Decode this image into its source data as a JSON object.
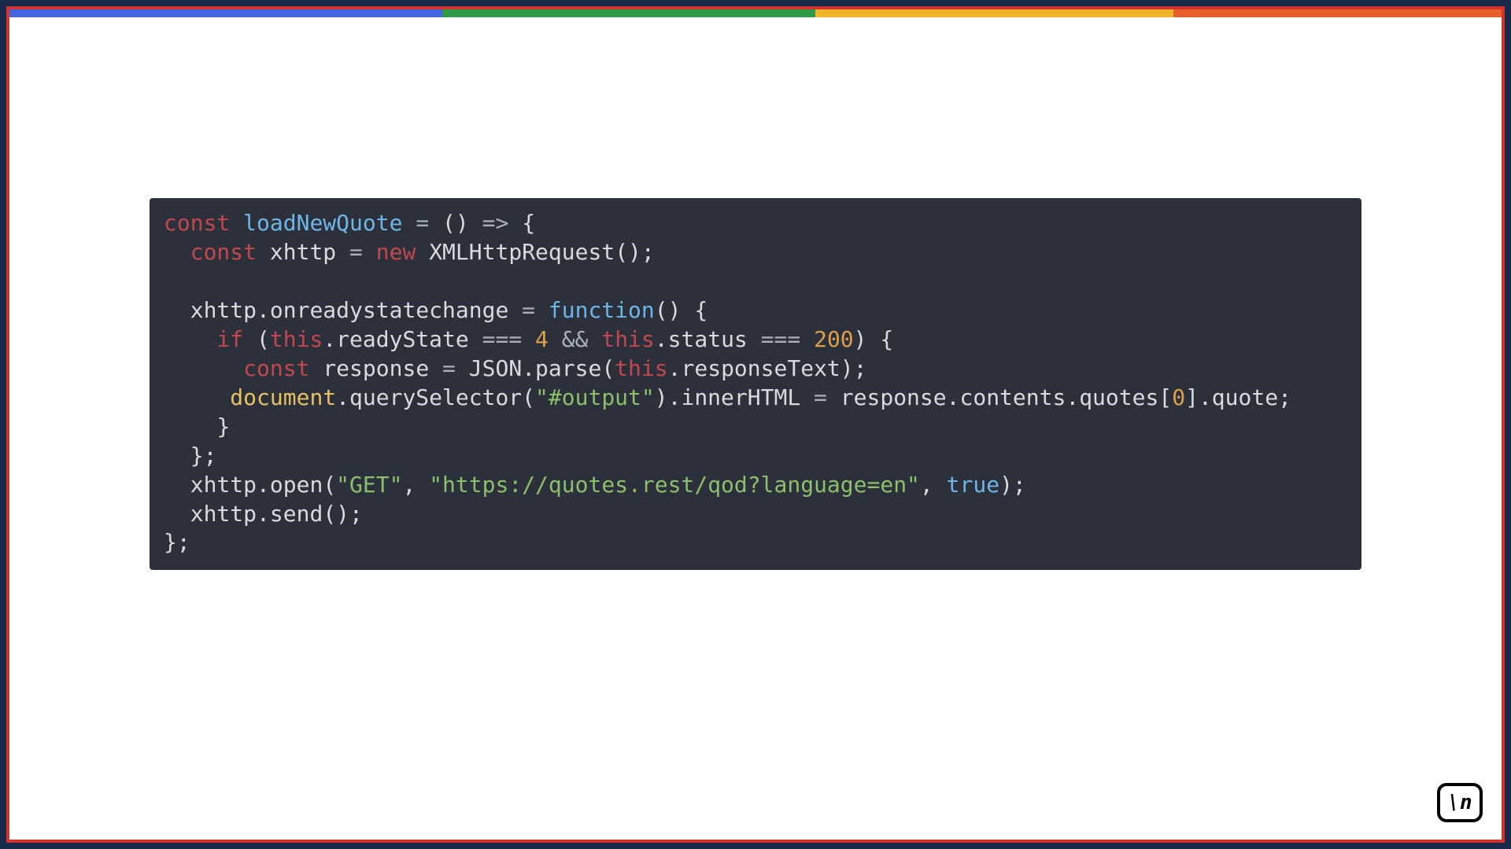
{
  "top_stripe_colors": [
    "#4366e0",
    "#2e9a47",
    "#f0b429",
    "#e95f2b"
  ],
  "frame_border_color": "#d0342c",
  "code_background": "#2b303b",
  "badge_text": "\\n",
  "code": {
    "tokens": [
      [
        {
          "t": "const",
          "c": "kw"
        },
        {
          "t": " "
        },
        {
          "t": "loadNewQuote",
          "c": "fn"
        },
        {
          "t": " "
        },
        {
          "t": "=",
          "c": "op"
        },
        {
          "t": " "
        },
        {
          "t": "(",
          "c": "punc"
        },
        {
          "t": ")",
          "c": "punc"
        },
        {
          "t": " "
        },
        {
          "t": "=>",
          "c": "op"
        },
        {
          "t": " "
        },
        {
          "t": "{",
          "c": "punc"
        }
      ],
      [
        {
          "t": "  "
        },
        {
          "t": "const",
          "c": "kw"
        },
        {
          "t": " "
        },
        {
          "t": "xhttp",
          "c": "def"
        },
        {
          "t": " "
        },
        {
          "t": "=",
          "c": "op"
        },
        {
          "t": " "
        },
        {
          "t": "new",
          "c": "new"
        },
        {
          "t": " "
        },
        {
          "t": "XMLHttpRequest",
          "c": "type"
        },
        {
          "t": "();",
          "c": "punc"
        }
      ],
      [
        {
          "t": " "
        }
      ],
      [
        {
          "t": "  "
        },
        {
          "t": "xhttp",
          "c": "def"
        },
        {
          "t": ".",
          "c": "punc"
        },
        {
          "t": "onreadystatechange",
          "c": "prop"
        },
        {
          "t": " "
        },
        {
          "t": "=",
          "c": "op"
        },
        {
          "t": " "
        },
        {
          "t": "function",
          "c": "funcdef"
        },
        {
          "t": "()",
          "c": "punc"
        },
        {
          "t": " "
        },
        {
          "t": "{",
          "c": "punc"
        }
      ],
      [
        {
          "t": "    "
        },
        {
          "t": "if",
          "c": "kw"
        },
        {
          "t": " "
        },
        {
          "t": "(",
          "c": "punc"
        },
        {
          "t": "this",
          "c": "this"
        },
        {
          "t": ".",
          "c": "punc"
        },
        {
          "t": "readyState",
          "c": "prop"
        },
        {
          "t": " "
        },
        {
          "t": "===",
          "c": "op"
        },
        {
          "t": " "
        },
        {
          "t": "4",
          "c": "num"
        },
        {
          "t": " "
        },
        {
          "t": "&&",
          "c": "op"
        },
        {
          "t": " "
        },
        {
          "t": "this",
          "c": "this"
        },
        {
          "t": ".",
          "c": "punc"
        },
        {
          "t": "status",
          "c": "prop"
        },
        {
          "t": " "
        },
        {
          "t": "===",
          "c": "op"
        },
        {
          "t": " "
        },
        {
          "t": "200",
          "c": "num"
        },
        {
          "t": ")",
          "c": "punc"
        },
        {
          "t": " "
        },
        {
          "t": "{",
          "c": "punc"
        }
      ],
      [
        {
          "t": "      "
        },
        {
          "t": "const",
          "c": "kw"
        },
        {
          "t": " "
        },
        {
          "t": "response",
          "c": "def"
        },
        {
          "t": " "
        },
        {
          "t": "=",
          "c": "op"
        },
        {
          "t": " "
        },
        {
          "t": "JSON",
          "c": "type"
        },
        {
          "t": ".",
          "c": "punc"
        },
        {
          "t": "parse",
          "c": "func"
        },
        {
          "t": "(",
          "c": "punc"
        },
        {
          "t": "this",
          "c": "this"
        },
        {
          "t": ".",
          "c": "punc"
        },
        {
          "t": "responseText",
          "c": "prop"
        },
        {
          "t": ");",
          "c": "punc"
        }
      ],
      [
        {
          "t": "     "
        },
        {
          "t": "document",
          "c": "doc"
        },
        {
          "t": ".",
          "c": "punc"
        },
        {
          "t": "querySelector",
          "c": "func"
        },
        {
          "t": "(",
          "c": "punc"
        },
        {
          "t": "\"#output\"",
          "c": "str"
        },
        {
          "t": ")",
          "c": "punc"
        },
        {
          "t": ".",
          "c": "punc"
        },
        {
          "t": "innerHTML",
          "c": "prop"
        },
        {
          "t": " "
        },
        {
          "t": "=",
          "c": "op"
        },
        {
          "t": " "
        },
        {
          "t": "response",
          "c": "def"
        },
        {
          "t": ".",
          "c": "punc"
        },
        {
          "t": "contents",
          "c": "prop"
        },
        {
          "t": ".",
          "c": "punc"
        },
        {
          "t": "quotes",
          "c": "prop"
        },
        {
          "t": "[",
          "c": "punc"
        },
        {
          "t": "0",
          "c": "num"
        },
        {
          "t": "]",
          "c": "punc"
        },
        {
          "t": ".",
          "c": "punc"
        },
        {
          "t": "quote",
          "c": "prop"
        },
        {
          "t": ";",
          "c": "punc"
        }
      ],
      [
        {
          "t": "    "
        },
        {
          "t": "}",
          "c": "punc"
        }
      ],
      [
        {
          "t": "  "
        },
        {
          "t": "};",
          "c": "punc"
        }
      ],
      [
        {
          "t": "  "
        },
        {
          "t": "xhttp",
          "c": "def"
        },
        {
          "t": ".",
          "c": "punc"
        },
        {
          "t": "open",
          "c": "func"
        },
        {
          "t": "(",
          "c": "punc"
        },
        {
          "t": "\"GET\"",
          "c": "str"
        },
        {
          "t": ",",
          "c": "punc"
        },
        {
          "t": " "
        },
        {
          "t": "\"https://quotes.rest/qod?language=en\"",
          "c": "str"
        },
        {
          "t": ",",
          "c": "punc"
        },
        {
          "t": " "
        },
        {
          "t": "true",
          "c": "bool"
        },
        {
          "t": ");",
          "c": "punc"
        }
      ],
      [
        {
          "t": "  "
        },
        {
          "t": "xhttp",
          "c": "def"
        },
        {
          "t": ".",
          "c": "punc"
        },
        {
          "t": "send",
          "c": "func"
        },
        {
          "t": "();",
          "c": "punc"
        }
      ],
      [
        {
          "t": "};",
          "c": "punc"
        }
      ]
    ]
  }
}
